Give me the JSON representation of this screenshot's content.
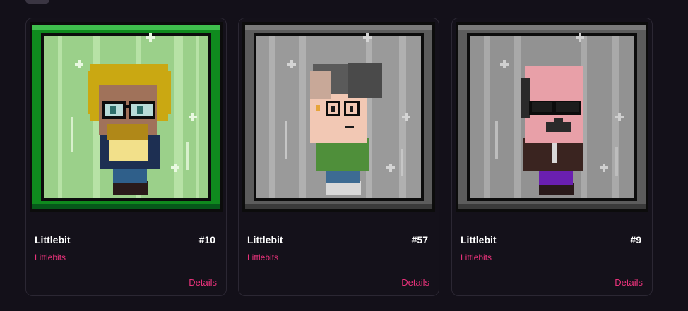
{
  "cards": [
    {
      "name": "Littlebit",
      "number": "#10",
      "collection": "Littlebits",
      "details_label": "Details",
      "frame_color": "#0f8a1e",
      "frame_dark": "#06591a",
      "bg_color": "#9bd08a",
      "bg_stripe": "#b7e2a6"
    },
    {
      "name": "Littlebit",
      "number": "#57",
      "collection": "Littlebits",
      "details_label": "Details",
      "frame_color": "#5c5c5c",
      "frame_dark": "#3a3a3a",
      "bg_color": "#9a9a9a",
      "bg_stripe": "#b0b0b0"
    },
    {
      "name": "Littlebit",
      "number": "#9",
      "collection": "Littlebits",
      "details_label": "Details",
      "frame_color": "#5c5c5c",
      "frame_dark": "#3a3a3a",
      "bg_color": "#929292",
      "bg_stripe": "#a9a9a9"
    }
  ]
}
